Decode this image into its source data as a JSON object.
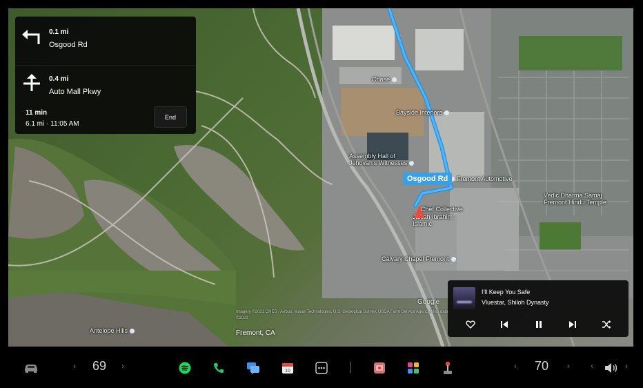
{
  "navigation": {
    "turns": [
      {
        "distance": "0.1 mi",
        "street": "Osgood Rd",
        "icon": "turn-left-arrow-icon"
      },
      {
        "distance": "0.4 mi",
        "street": "Auto Mall Pkwy",
        "icon": "intersection-arrow-icon"
      }
    ],
    "trip": {
      "duration": "11 min",
      "detail": "6.1 mi · 11:05 AM"
    },
    "end_label": "End"
  },
  "map": {
    "current_road_label": "Osgood Rd",
    "city_label": "Fremont, CA",
    "google_logo": "Google",
    "attribution": "Imagery ©2021 CNES / Airbus, Maxar Technologies, U.S. Geological Survey, USDA Farm Service Agency Map data ©2021",
    "places": [
      "Chase",
      "Bayside Interiors",
      "Assembly Hall of Jehovah's Witnesses",
      "Fremont Automotive",
      "Chef Collective",
      "Jalilah Ibrahim Islamic",
      "Vedic Dharma Samaj Fremont Hindu Temple",
      "Calvary Chapel Fremont",
      "Antelope Hills"
    ],
    "colors": {
      "route": "#3aa0e6",
      "vehicle": "#e84b3f"
    }
  },
  "media": {
    "title": "I'll Keep You Safe",
    "artist": "Vluestar, Shiloh Dynasty",
    "controls": [
      "heart-icon",
      "previous-track-icon",
      "pause-icon",
      "next-track-icon",
      "shuffle-icon"
    ]
  },
  "bottom_bar": {
    "driver_temp": "69",
    "passenger_temp": "70",
    "icons": [
      "car-icon",
      "spotify-icon",
      "phone-icon",
      "messages-icon",
      "calendar-icon",
      "more-apps-icon",
      "toybox-icon",
      "app-launcher-icon",
      "joystick-icon",
      "volume-icon"
    ]
  }
}
